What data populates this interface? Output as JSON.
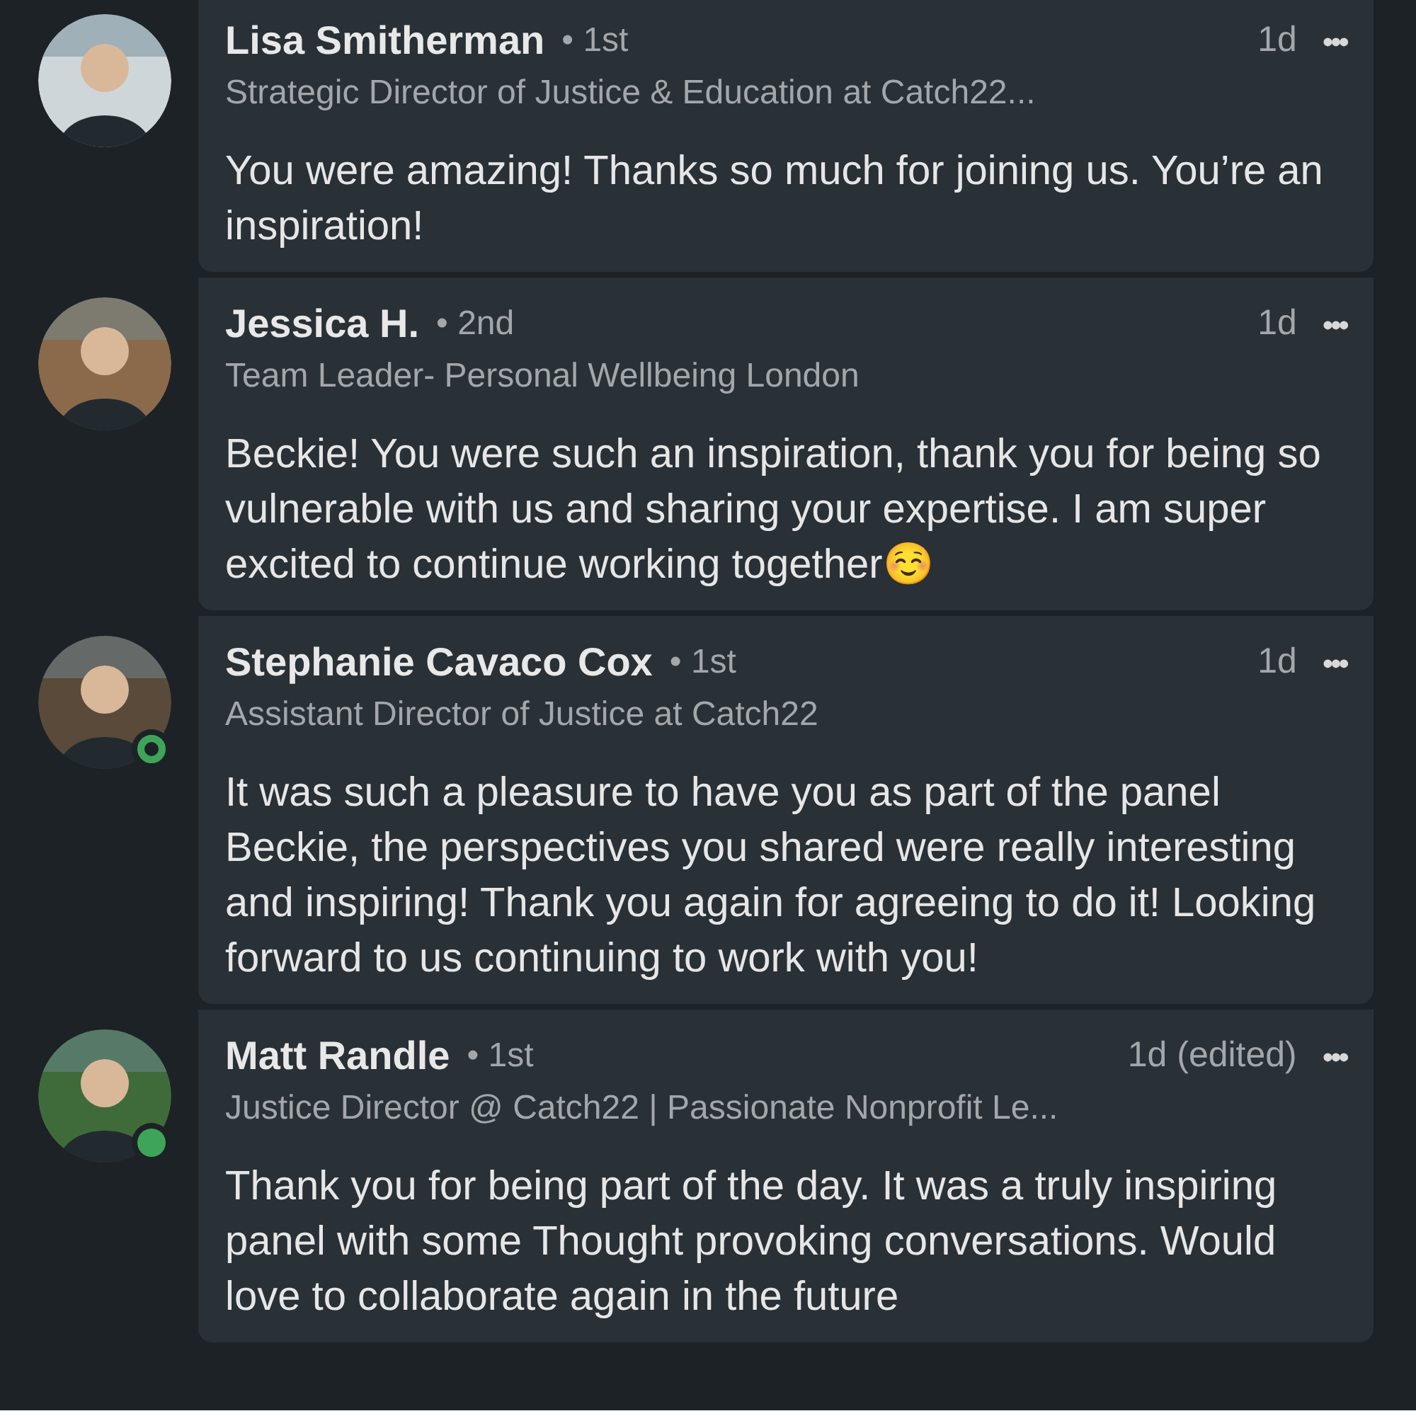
{
  "comments": [
    {
      "name": "Lisa Smitherman",
      "degree": "• 1st",
      "time": "1d",
      "more": "•••",
      "headline": "Strategic Director of Justice & Education at Catch22...",
      "text": "You were amazing! Thanks so much for joining us. You’re an inspiration!",
      "online": false
    },
    {
      "name": "Jessica H.",
      "degree": "• 2nd",
      "time": "1d",
      "more": "•••",
      "headline": "Team Leader- Personal Wellbeing London",
      "text": "Beckie! You were such an inspiration, thank you for being so vulnerable with us and sharing your expertise. I am super excited to continue working together☺️",
      "online": false
    },
    {
      "name": "Stephanie Cavaco Cox",
      "degree": "• 1st",
      "time": "1d",
      "more": "•••",
      "headline": "Assistant Director of Justice at Catch22",
      "text": "It was such a pleasure to have you as part of the panel Beckie, the perspectives you shared were really interesting and inspiring! Thank you again for agreeing to do it! Looking forward to us continuing to work with you!",
      "online": true,
      "hollow": true
    },
    {
      "name": "Matt Randle",
      "degree": "• 1st",
      "time": "1d (edited)",
      "more": "•••",
      "headline": "Justice Director @ Catch22 | Passionate Nonprofit Le...",
      "text": "Thank you for being part of the day. It was a truly inspiring panel with some Thought provoking conversations. Would love to collaborate again in the future",
      "online": true,
      "hollow": false
    }
  ]
}
